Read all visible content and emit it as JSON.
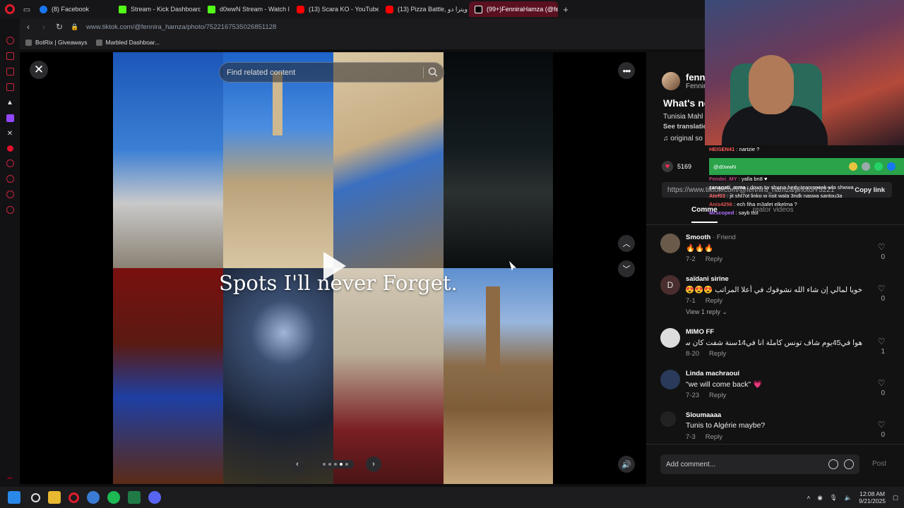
{
  "browser": {
    "tabs": [
      {
        "label": "(8) Facebook",
        "icon": "facebook-icon",
        "active": false
      },
      {
        "label": "Stream - Kick Dashboard",
        "icon": "kick-icon",
        "active": false
      },
      {
        "label": "d0wwN Stream - Watch l",
        "icon": "kick-icon",
        "active": false
      },
      {
        "label": "(13) Scara KO - YouTube",
        "icon": "youtube-icon",
        "active": false
      },
      {
        "label": "(13) Pizza Battle, ؟ ويترا دو",
        "icon": "youtube-icon",
        "active": false
      },
      {
        "label": "(99+)FenniraHamza (@fe",
        "icon": "tiktok-icon",
        "active": true
      }
    ],
    "url": "www.tiktok.com/@fennira_hamza/photo/7522167535026851128",
    "bookmarks": [
      "BotRix | Giveaways",
      "Marbled Dashboar..."
    ]
  },
  "viewer": {
    "search_placeholder": "Find related content",
    "overlay_text": "Spots I'll never Forget.",
    "carousel_dots": 5,
    "carousel_active_index": 3
  },
  "post": {
    "author_name": "fenni",
    "author_sub": "Fennir",
    "title": "What's ne",
    "description": "Tunisia Mahl",
    "see_translation": "See translatio",
    "sound": "♫  original so",
    "likes": "5169",
    "share_link": "https://www.tiktok.com/@fennira_hamza/photo/75221",
    "copy_link_label": "Copy link",
    "tab_comments": "Comme",
    "tab_creator": "reator videos"
  },
  "comments": [
    {
      "name": "Smooth",
      "badge": "· Friend",
      "text": "🔥🔥🔥",
      "date": "7-2",
      "reply": "Reply",
      "likes": "0",
      "avatar": ""
    },
    {
      "name": "saïdani sirine",
      "badge": "",
      "text": "خويا لمالي إن شاء الله نشوفوك في أعلا المراتب 😍😍😍",
      "date": "7-1",
      "reply": "Reply",
      "likes": "0",
      "avatar": "D",
      "view_replies": "View 1 reply ⌄"
    },
    {
      "name": "MIMO FF",
      "badge": "",
      "text": "هوا في45يوم شاف تونس كاملة انا في14سنة شفت كان سوسة 😂😂",
      "date": "8-20",
      "reply": "Reply",
      "likes": "1",
      "avatar": ""
    },
    {
      "name": "Linda machraoui",
      "badge": "",
      "text": "\"we will come back\" 💗",
      "date": "7-23",
      "reply": "Reply",
      "likes": "0",
      "avatar": ""
    },
    {
      "name": "Sloumaaaa",
      "badge": "",
      "text": "Tunis to Algérie maybe?",
      "date": "7-3",
      "reply": "Reply",
      "likes": "0",
      "avatar": ""
    }
  ],
  "comment_bar": {
    "placeholder": "Add comment...",
    "post_label": "Post"
  },
  "chat": {
    "lines": [
      {
        "user": "HEISEN41",
        "color": "#ff5a5a",
        "msg": " : nartzie ?"
      },
      {
        "user": "Fendei_MY",
        "color": "#c04080",
        "msg": " : yalla bn8 ♥"
      },
      {
        "user": "zanagati_mma",
        "color": "#ffffff",
        "msg": " : down tw shwna hedy teamspeak wla shwwa"
      },
      {
        "user": "Atef03",
        "color": "#ff6a6a",
        "msg": " : jit sht7ot linko w nsit wala 3ndk naswa santou3a"
      },
      {
        "user": "Anis4256",
        "color": "#e05050",
        "msg": " : ech fiha m3afet elkelma ?"
      },
      {
        "user": "Mrscoped",
        "color": "#b070ff",
        "msg": " : sayb tfol"
      }
    ],
    "banner_text": "@d0wwN"
  },
  "taskbar": {
    "time": "12:08 AM",
    "date": "9/21/2025"
  }
}
